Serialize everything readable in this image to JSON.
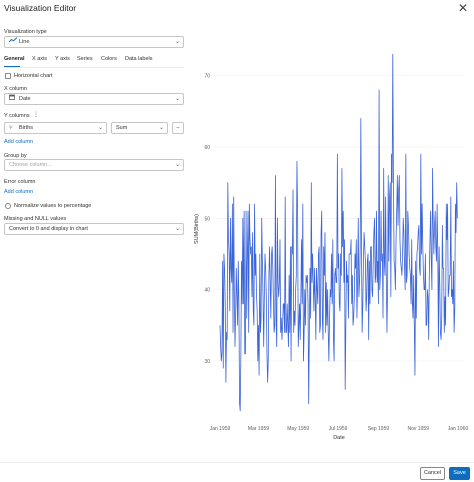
{
  "window": {
    "title": "Visualization Editor"
  },
  "viz_type": {
    "label": "Visualization type",
    "value": "Line"
  },
  "tabs": [
    "General",
    "X axis",
    "Y axis",
    "Series",
    "Colors",
    "Data labels"
  ],
  "general": {
    "horizontal_chart": "Horizontal chart",
    "x_column_label": "X column",
    "x_column_value": "Date",
    "y_columns_label": "Y columns",
    "y_column_value": "Births",
    "y_agg_value": "Sum",
    "add_column": "Add column",
    "group_by_label": "Group by",
    "group_by_placeholder": "Choose column...",
    "error_column_label": "Error column",
    "add_column_2": "Add column",
    "normalize": "Normalize values to percentage",
    "missing_label": "Missing and NULL values",
    "missing_value": "Convert to 0 and display in chart"
  },
  "footer": {
    "cancel": "Cancel",
    "save": "Save"
  },
  "colors": {
    "accent": "#0f6cbd",
    "series": "#3b64d8"
  },
  "chart_data": {
    "type": "line",
    "xlabel": "Date",
    "ylabel": "SUM(Births)",
    "x_ticks": [
      "Jan 1959",
      "Mar 1959",
      "May 1959",
      "Jul 1959",
      "Sep 1959",
      "Nov 1959",
      "Jan 1960"
    ],
    "y_ticks": [
      30,
      40,
      50,
      60,
      70
    ],
    "ylim": [
      22,
      75
    ],
    "xlim": [
      "1959-01-01",
      "1960-01-01"
    ],
    "grid": "horizontal",
    "series": [
      {
        "x_start": "1959-01-01",
        "x_step_days": 1,
        "values": [
          35,
          32,
          30,
          31,
          44,
          29,
          45,
          43,
          38,
          27,
          34,
          33,
          55,
          47,
          45,
          37,
          50,
          43,
          41,
          52,
          34,
          53,
          39,
          32,
          37,
          43,
          39,
          35,
          44,
          38,
          24,
          23,
          31,
          44,
          38,
          50,
          38,
          51,
          31,
          31,
          51,
          36,
          45,
          51,
          34,
          52,
          47,
          45,
          46,
          39,
          48,
          37,
          35,
          52,
          42,
          45,
          39,
          37,
          30,
          35,
          28,
          45,
          34,
          36,
          50,
          44,
          39,
          32,
          39,
          45,
          43,
          39,
          31,
          27,
          30,
          42,
          46,
          41,
          36,
          45,
          46,
          43,
          38,
          34,
          35,
          56,
          36,
          32,
          50,
          41,
          39,
          41,
          47,
          34,
          36,
          33,
          35,
          38,
          38,
          34,
          53,
          34,
          34,
          38,
          35,
          32,
          42,
          34,
          46,
          30,
          46,
          45,
          54,
          34,
          37,
          35,
          40,
          42,
          58,
          51,
          32,
          35,
          38,
          33,
          39,
          47,
          38,
          52,
          30,
          34,
          40,
          35,
          42,
          41,
          42,
          38,
          24,
          34,
          43,
          36,
          55,
          41,
          45,
          41,
          37,
          43,
          39,
          33,
          43,
          40,
          38,
          45,
          46,
          34,
          35,
          48,
          51,
          36,
          33,
          46,
          42,
          48,
          34,
          41,
          35,
          40,
          34,
          30,
          36,
          40,
          39,
          45,
          38,
          47,
          33,
          30,
          42,
          43,
          41,
          41,
          59,
          43,
          45,
          38,
          37,
          45,
          42,
          57,
          46,
          51,
          41,
          47,
          26,
          35,
          44,
          41,
          42,
          36,
          45,
          45,
          45,
          47,
          38,
          42,
          35,
          36,
          39,
          45,
          43,
          47,
          36,
          41,
          50,
          39,
          41,
          46,
          64,
          45,
          34,
          38,
          44,
          48,
          46,
          44,
          37,
          39,
          44,
          45,
          33,
          44,
          38,
          46,
          46,
          40,
          39,
          44,
          48,
          50,
          41,
          42,
          51,
          41,
          44,
          38,
          68,
          40,
          42,
          51,
          44,
          45,
          36,
          57,
          44,
          42,
          53,
          42,
          34,
          40,
          56,
          44,
          53,
          55,
          39,
          59,
          55,
          73,
          55,
          44,
          43,
          40,
          47,
          51,
          56,
          49,
          54,
          56,
          47,
          44,
          43,
          42,
          45,
          50,
          48,
          43,
          40,
          59,
          41,
          42,
          51,
          49,
          45,
          43,
          42,
          38,
          47,
          38,
          36,
          42,
          35,
          28,
          44,
          36,
          45,
          46,
          48,
          49,
          43,
          42,
          59,
          45,
          52,
          46,
          42,
          40,
          40,
          45,
          35,
          35,
          40,
          39,
          33,
          42,
          47,
          51,
          44,
          40,
          57,
          49,
          45,
          49,
          51,
          46,
          44,
          52,
          45,
          32,
          46,
          41,
          34,
          33,
          36,
          49,
          43,
          43,
          34,
          39,
          35,
          52,
          47,
          52,
          39,
          40,
          42,
          42,
          53,
          39,
          40,
          38,
          44,
          34,
          37,
          52,
          48,
          55,
          50
        ]
      }
    ]
  }
}
